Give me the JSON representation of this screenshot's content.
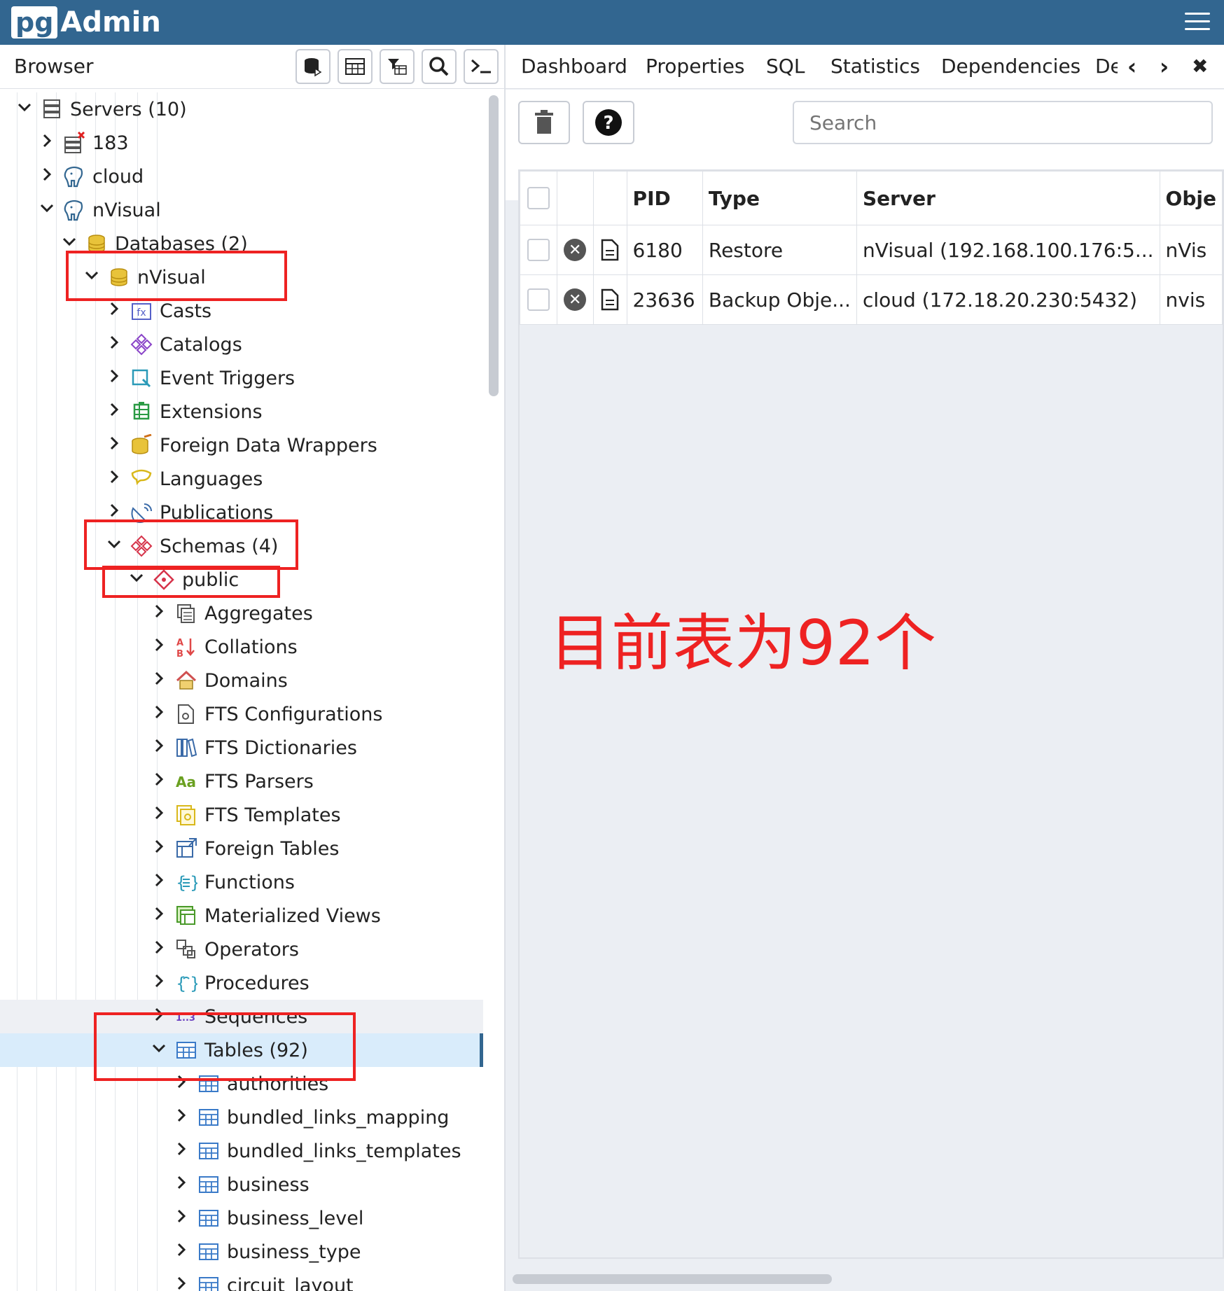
{
  "app": {
    "logo_pg": "pg",
    "logo_admin": "Admin"
  },
  "browser": {
    "title": "Browser",
    "toolbar_icons": [
      "database-query-icon",
      "table-view-icon",
      "filter-table-icon",
      "search-icon",
      "terminal-icon"
    ]
  },
  "tree": [
    {
      "label": "Servers (10)",
      "icon": "servers-icon",
      "depth": 0,
      "expanded": true
    },
    {
      "label": "183",
      "icon": "server-disconnected-icon",
      "depth": 1,
      "expanded": false
    },
    {
      "label": "cloud",
      "icon": "postgres-elephant-icon",
      "depth": 1,
      "expanded": false
    },
    {
      "label": "nVisual",
      "icon": "postgres-elephant-icon",
      "depth": 1,
      "expanded": true
    },
    {
      "label": "Databases (2)",
      "icon": "databases-icon",
      "depth": 2,
      "expanded": true
    },
    {
      "label": "nVisual",
      "icon": "database-icon",
      "depth": 3,
      "expanded": true
    },
    {
      "label": "Casts",
      "icon": "casts-icon",
      "depth": 4,
      "expanded": false
    },
    {
      "label": "Catalogs",
      "icon": "catalogs-icon",
      "depth": 4,
      "expanded": false
    },
    {
      "label": "Event Triggers",
      "icon": "event-triggers-icon",
      "depth": 4,
      "expanded": false
    },
    {
      "label": "Extensions",
      "icon": "extensions-icon",
      "depth": 4,
      "expanded": false
    },
    {
      "label": "Foreign Data Wrappers",
      "icon": "fdw-icon",
      "depth": 4,
      "expanded": false
    },
    {
      "label": "Languages",
      "icon": "languages-icon",
      "depth": 4,
      "expanded": false
    },
    {
      "label": "Publications",
      "icon": "publications-icon",
      "depth": 4,
      "expanded": false
    },
    {
      "label": "Schemas (4)",
      "icon": "schemas-icon",
      "depth": 4,
      "expanded": true
    },
    {
      "label": "public",
      "icon": "schema-icon",
      "depth": 5,
      "expanded": true
    },
    {
      "label": "Aggregates",
      "icon": "aggregates-icon",
      "depth": 6,
      "expanded": false
    },
    {
      "label": "Collations",
      "icon": "collations-icon",
      "depth": 6,
      "expanded": false
    },
    {
      "label": "Domains",
      "icon": "domains-icon",
      "depth": 6,
      "expanded": false
    },
    {
      "label": "FTS Configurations",
      "icon": "fts-configurations-icon",
      "depth": 6,
      "expanded": false
    },
    {
      "label": "FTS Dictionaries",
      "icon": "fts-dictionaries-icon",
      "depth": 6,
      "expanded": false
    },
    {
      "label": "FTS Parsers",
      "icon": "fts-parsers-icon",
      "depth": 6,
      "expanded": false
    },
    {
      "label": "FTS Templates",
      "icon": "fts-templates-icon",
      "depth": 6,
      "expanded": false
    },
    {
      "label": "Foreign Tables",
      "icon": "foreign-tables-icon",
      "depth": 6,
      "expanded": false
    },
    {
      "label": "Functions",
      "icon": "functions-icon",
      "depth": 6,
      "expanded": false
    },
    {
      "label": "Materialized Views",
      "icon": "materialized-views-icon",
      "depth": 6,
      "expanded": false
    },
    {
      "label": "Operators",
      "icon": "operators-icon",
      "depth": 6,
      "expanded": false
    },
    {
      "label": "Procedures",
      "icon": "procedures-icon",
      "depth": 6,
      "expanded": false
    },
    {
      "label": "Sequences",
      "icon": "sequences-icon",
      "depth": 6,
      "expanded": false
    },
    {
      "label": "Tables (92)",
      "icon": "tables-icon",
      "depth": 6,
      "expanded": true,
      "selected": true
    },
    {
      "label": "authorities",
      "icon": "table-icon",
      "depth": 7,
      "expanded": false
    },
    {
      "label": "bundled_links_mapping",
      "icon": "table-icon",
      "depth": 7,
      "expanded": false
    },
    {
      "label": "bundled_links_templates",
      "icon": "table-icon",
      "depth": 7,
      "expanded": false
    },
    {
      "label": "business",
      "icon": "table-icon",
      "depth": 7,
      "expanded": false
    },
    {
      "label": "business_level",
      "icon": "table-icon",
      "depth": 7,
      "expanded": false
    },
    {
      "label": "business_type",
      "icon": "table-icon",
      "depth": 7,
      "expanded": false
    },
    {
      "label": "circuit_layout",
      "icon": "table-icon",
      "depth": 7,
      "expanded": false
    }
  ],
  "tabs": [
    "Dashboard",
    "Properties",
    "SQL",
    "Statistics",
    "Dependencies",
    "De"
  ],
  "toolbar": {
    "delete_icon": "trash-icon",
    "help_icon": "help-icon",
    "search_placeholder": "Search"
  },
  "table": {
    "headers": [
      "",
      "",
      "",
      "PID",
      "Type",
      "Server",
      "Obje"
    ],
    "rows": [
      {
        "pid": "6180",
        "type": "Restore",
        "server": "nVisual (192.168.100.176:5...",
        "object": "nVis"
      },
      {
        "pid": "23636",
        "type": "Backup Obje...",
        "server": "cloud (172.18.20.230:5432)",
        "object": "nvis"
      }
    ]
  },
  "annotation": "目前表为92个",
  "colors": {
    "topbar": "#326690",
    "annotation": "#ee2222",
    "selected_row": "#d9ecfb"
  }
}
